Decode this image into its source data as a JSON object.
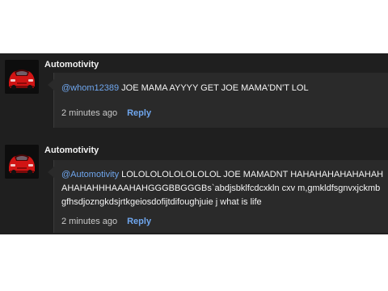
{
  "comments": [
    {
      "author": "Automotivity",
      "avatar_icon": "red-car-icon",
      "mention": "@whom12389",
      "text": " JOE MAMA AYYYY GET JOE MAMA'DN'T LOL",
      "timestamp": "2 minutes ago",
      "reply_label": "Reply"
    },
    {
      "author": "Automotivity",
      "avatar_icon": "red-car-icon",
      "mention": "@Automotivity",
      "text": " LOLOLOLOLOLOLOLOL JOE MAMADNT HAHAHAHAHAHAHAHAHAHAHHHAAAHAHGGGBBGGGBs`abdjsbklfcdcxkln cxv m,gmkldfsgnvxjckmbgfhsdjozngkdsjrtkgeiosdofijtdifoughjuie j what is life",
      "timestamp": "2 minutes ago",
      "reply_label": "Reply"
    }
  ],
  "colors": {
    "panel_bg": "#1f1f1f",
    "bubble_bg": "#2a2a2a",
    "link": "#6fa6ee",
    "text": "#f4f4f4"
  }
}
